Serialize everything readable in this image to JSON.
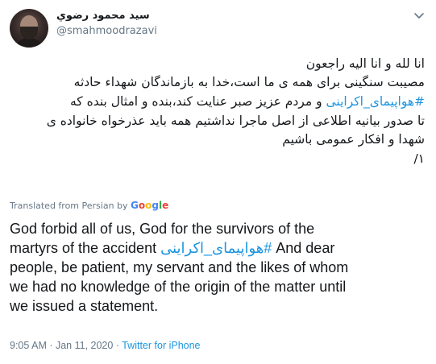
{
  "author": {
    "display_name": "سید محمود رضوي",
    "handle": "@smahmoodrazavi"
  },
  "original": {
    "line1": "انا لله و انا الیه راجعون",
    "line2": "مصیبت سنگینی برای همه ی ما است،خدا به بازماندگان شهداء حادثه",
    "line3_hashtag": "#هواپیمای_اکراینی",
    "line3_text": " و مردم عزیز صبر عنایت کند،بنده و امثال بنده که",
    "line4": "تا صدور بیانیه اطلاعی از اصل ماجرا نداشتیم همه باید عذرخواه خانواده ی",
    "line5": "شهدا و افکار عمومی باشیم",
    "line6": "۱/"
  },
  "translation": {
    "label": "Translated from Persian by",
    "google": [
      "G",
      "o",
      "o",
      "g",
      "l",
      "e"
    ],
    "line1": "God forbid all of us, God for the survivors of the",
    "line2_text": "martyrs of the accident ",
    "line2_hashtag": "#هواپیمای_اکراینی",
    "line2_tail": " And dear",
    "line3": "people, be patient, my servant and the likes of whom",
    "line4": "we had no knowledge of the origin of the matter until",
    "line5": "we issued a statement."
  },
  "meta": {
    "time": "9:05 AM",
    "separator1": " · ",
    "date": "Jan 11, 2020",
    "separator2": " · ",
    "source": "Twitter for iPhone"
  },
  "colors": {
    "link": "#1b95e0",
    "muted": "#657786",
    "text": "#14171a"
  },
  "icons": {
    "more": "chevron-down-icon"
  }
}
